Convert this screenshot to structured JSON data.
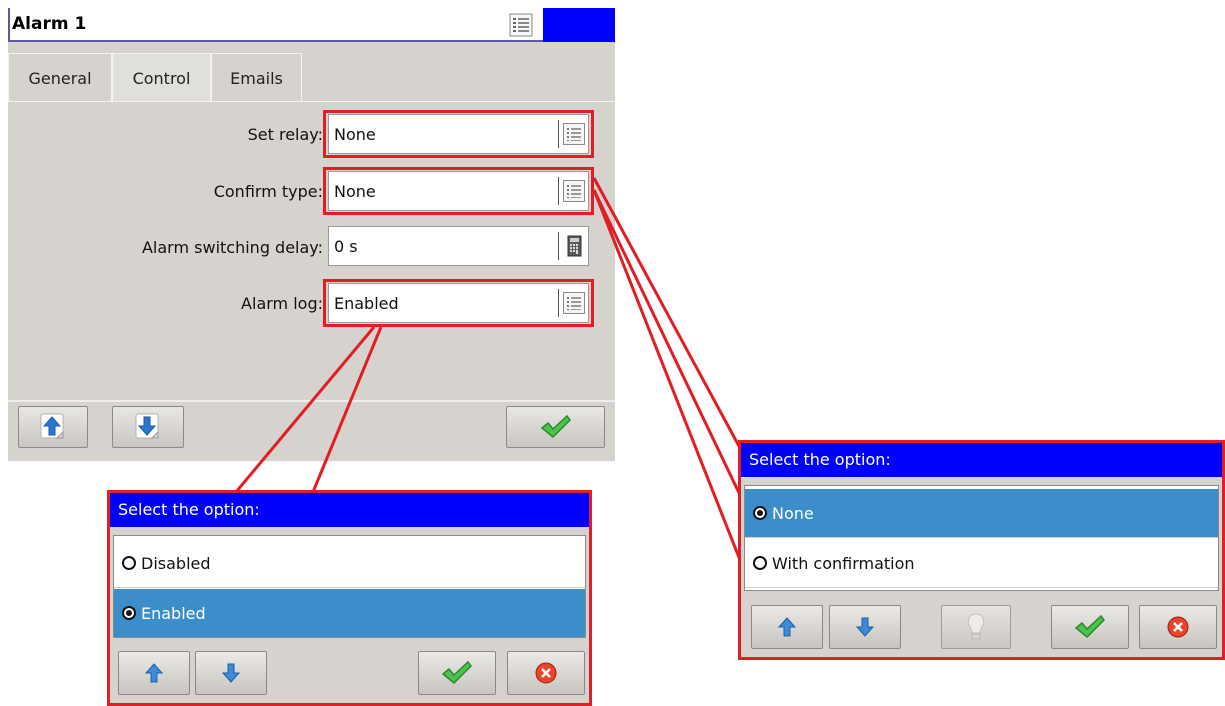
{
  "window": {
    "title": "Alarm 1",
    "tabs": [
      {
        "label": "General",
        "active": false
      },
      {
        "label": "Control",
        "active": true
      },
      {
        "label": "Emails",
        "active": false
      }
    ],
    "fields": [
      {
        "label": "Set relay:",
        "value": "None",
        "icon": "list-icon"
      },
      {
        "label": "Confirm type:",
        "value": "None",
        "icon": "list-icon"
      },
      {
        "label": "Alarm switching delay:",
        "value": "0 s",
        "icon": "calculator-icon"
      },
      {
        "label": "Alarm log:",
        "value": "Enabled",
        "icon": "list-icon"
      }
    ]
  },
  "popup_log": {
    "title": "Select the option:",
    "options": [
      {
        "label": "Disabled",
        "selected": false
      },
      {
        "label": "Enabled",
        "selected": true
      }
    ]
  },
  "popup_confirm": {
    "title": "Select the option:",
    "options": [
      {
        "label": "None",
        "selected": true
      },
      {
        "label": "With confirmation",
        "selected": false
      }
    ]
  },
  "colors": {
    "highlight": "#e11d25",
    "title_blue": "#0000ff",
    "selected_row": "#3b8ec9",
    "panel": "#d6d3ce"
  }
}
